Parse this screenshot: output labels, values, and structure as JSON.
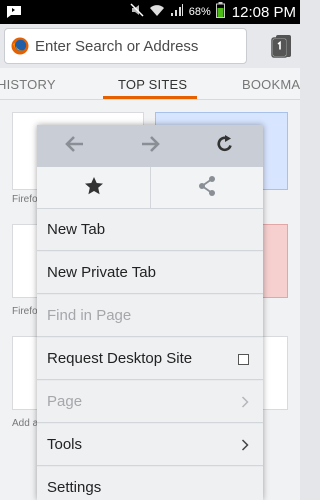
{
  "status_bar": {
    "battery_percent": "68%",
    "time": "12:08 PM"
  },
  "toolbar": {
    "url_placeholder": "Enter Search or Address"
  },
  "tabs": [
    {
      "label": "HISTORY"
    },
    {
      "label": "TOP SITES"
    },
    {
      "label": "BOOKMARKS"
    }
  ],
  "top_sites": {
    "labels": [
      "Firefox",
      "Firefox",
      "Add a"
    ]
  },
  "menu": {
    "items": [
      {
        "label": "New Tab"
      },
      {
        "label": "New Private Tab"
      },
      {
        "label": "Find in Page"
      },
      {
        "label": "Request Desktop Site"
      },
      {
        "label": "Page"
      },
      {
        "label": "Tools"
      },
      {
        "label": "Settings"
      }
    ]
  },
  "colors": {
    "accent": "#e66000",
    "menu_nav_bg": "#c9ced6",
    "disabled_text": "#a5a7ab"
  }
}
